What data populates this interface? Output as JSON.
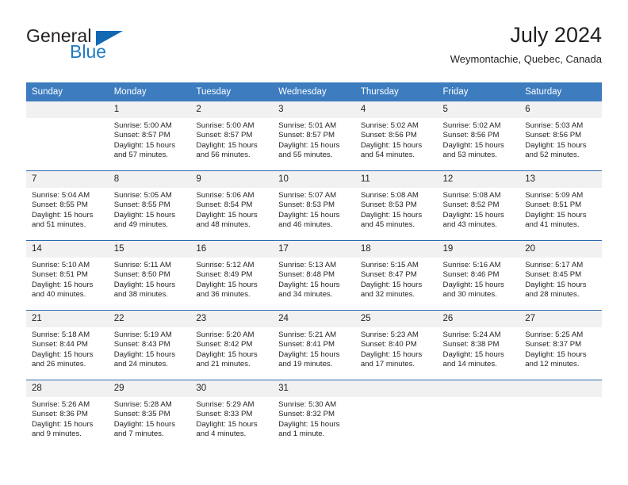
{
  "brand": {
    "name_top": "General",
    "name_bottom": "Blue",
    "accent_color": "#1268b3",
    "text_color": "#231f20"
  },
  "header": {
    "title": "July 2024",
    "location": "Weymontachie, Quebec, Canada"
  },
  "theme": {
    "header_bar_color": "#3c7cbf",
    "row_divider_color": "#2a6cad",
    "daynum_band_color": "#f1f1f1"
  },
  "weekday_headers": [
    "Sunday",
    "Monday",
    "Tuesday",
    "Wednesday",
    "Thursday",
    "Friday",
    "Saturday"
  ],
  "weeks": [
    [
      {
        "day": "",
        "sunrise": "",
        "sunset": "",
        "daylight_line1": "",
        "daylight_line2": ""
      },
      {
        "day": "1",
        "sunrise": "Sunrise: 5:00 AM",
        "sunset": "Sunset: 8:57 PM",
        "daylight_line1": "Daylight: 15 hours",
        "daylight_line2": "and 57 minutes."
      },
      {
        "day": "2",
        "sunrise": "Sunrise: 5:00 AM",
        "sunset": "Sunset: 8:57 PM",
        "daylight_line1": "Daylight: 15 hours",
        "daylight_line2": "and 56 minutes."
      },
      {
        "day": "3",
        "sunrise": "Sunrise: 5:01 AM",
        "sunset": "Sunset: 8:57 PM",
        "daylight_line1": "Daylight: 15 hours",
        "daylight_line2": "and 55 minutes."
      },
      {
        "day": "4",
        "sunrise": "Sunrise: 5:02 AM",
        "sunset": "Sunset: 8:56 PM",
        "daylight_line1": "Daylight: 15 hours",
        "daylight_line2": "and 54 minutes."
      },
      {
        "day": "5",
        "sunrise": "Sunrise: 5:02 AM",
        "sunset": "Sunset: 8:56 PM",
        "daylight_line1": "Daylight: 15 hours",
        "daylight_line2": "and 53 minutes."
      },
      {
        "day": "6",
        "sunrise": "Sunrise: 5:03 AM",
        "sunset": "Sunset: 8:56 PM",
        "daylight_line1": "Daylight: 15 hours",
        "daylight_line2": "and 52 minutes."
      }
    ],
    [
      {
        "day": "7",
        "sunrise": "Sunrise: 5:04 AM",
        "sunset": "Sunset: 8:55 PM",
        "daylight_line1": "Daylight: 15 hours",
        "daylight_line2": "and 51 minutes."
      },
      {
        "day": "8",
        "sunrise": "Sunrise: 5:05 AM",
        "sunset": "Sunset: 8:55 PM",
        "daylight_line1": "Daylight: 15 hours",
        "daylight_line2": "and 49 minutes."
      },
      {
        "day": "9",
        "sunrise": "Sunrise: 5:06 AM",
        "sunset": "Sunset: 8:54 PM",
        "daylight_line1": "Daylight: 15 hours",
        "daylight_line2": "and 48 minutes."
      },
      {
        "day": "10",
        "sunrise": "Sunrise: 5:07 AM",
        "sunset": "Sunset: 8:53 PM",
        "daylight_line1": "Daylight: 15 hours",
        "daylight_line2": "and 46 minutes."
      },
      {
        "day": "11",
        "sunrise": "Sunrise: 5:08 AM",
        "sunset": "Sunset: 8:53 PM",
        "daylight_line1": "Daylight: 15 hours",
        "daylight_line2": "and 45 minutes."
      },
      {
        "day": "12",
        "sunrise": "Sunrise: 5:08 AM",
        "sunset": "Sunset: 8:52 PM",
        "daylight_line1": "Daylight: 15 hours",
        "daylight_line2": "and 43 minutes."
      },
      {
        "day": "13",
        "sunrise": "Sunrise: 5:09 AM",
        "sunset": "Sunset: 8:51 PM",
        "daylight_line1": "Daylight: 15 hours",
        "daylight_line2": "and 41 minutes."
      }
    ],
    [
      {
        "day": "14",
        "sunrise": "Sunrise: 5:10 AM",
        "sunset": "Sunset: 8:51 PM",
        "daylight_line1": "Daylight: 15 hours",
        "daylight_line2": "and 40 minutes."
      },
      {
        "day": "15",
        "sunrise": "Sunrise: 5:11 AM",
        "sunset": "Sunset: 8:50 PM",
        "daylight_line1": "Daylight: 15 hours",
        "daylight_line2": "and 38 minutes."
      },
      {
        "day": "16",
        "sunrise": "Sunrise: 5:12 AM",
        "sunset": "Sunset: 8:49 PM",
        "daylight_line1": "Daylight: 15 hours",
        "daylight_line2": "and 36 minutes."
      },
      {
        "day": "17",
        "sunrise": "Sunrise: 5:13 AM",
        "sunset": "Sunset: 8:48 PM",
        "daylight_line1": "Daylight: 15 hours",
        "daylight_line2": "and 34 minutes."
      },
      {
        "day": "18",
        "sunrise": "Sunrise: 5:15 AM",
        "sunset": "Sunset: 8:47 PM",
        "daylight_line1": "Daylight: 15 hours",
        "daylight_line2": "and 32 minutes."
      },
      {
        "day": "19",
        "sunrise": "Sunrise: 5:16 AM",
        "sunset": "Sunset: 8:46 PM",
        "daylight_line1": "Daylight: 15 hours",
        "daylight_line2": "and 30 minutes."
      },
      {
        "day": "20",
        "sunrise": "Sunrise: 5:17 AM",
        "sunset": "Sunset: 8:45 PM",
        "daylight_line1": "Daylight: 15 hours",
        "daylight_line2": "and 28 minutes."
      }
    ],
    [
      {
        "day": "21",
        "sunrise": "Sunrise: 5:18 AM",
        "sunset": "Sunset: 8:44 PM",
        "daylight_line1": "Daylight: 15 hours",
        "daylight_line2": "and 26 minutes."
      },
      {
        "day": "22",
        "sunrise": "Sunrise: 5:19 AM",
        "sunset": "Sunset: 8:43 PM",
        "daylight_line1": "Daylight: 15 hours",
        "daylight_line2": "and 24 minutes."
      },
      {
        "day": "23",
        "sunrise": "Sunrise: 5:20 AM",
        "sunset": "Sunset: 8:42 PM",
        "daylight_line1": "Daylight: 15 hours",
        "daylight_line2": "and 21 minutes."
      },
      {
        "day": "24",
        "sunrise": "Sunrise: 5:21 AM",
        "sunset": "Sunset: 8:41 PM",
        "daylight_line1": "Daylight: 15 hours",
        "daylight_line2": "and 19 minutes."
      },
      {
        "day": "25",
        "sunrise": "Sunrise: 5:23 AM",
        "sunset": "Sunset: 8:40 PM",
        "daylight_line1": "Daylight: 15 hours",
        "daylight_line2": "and 17 minutes."
      },
      {
        "day": "26",
        "sunrise": "Sunrise: 5:24 AM",
        "sunset": "Sunset: 8:38 PM",
        "daylight_line1": "Daylight: 15 hours",
        "daylight_line2": "and 14 minutes."
      },
      {
        "day": "27",
        "sunrise": "Sunrise: 5:25 AM",
        "sunset": "Sunset: 8:37 PM",
        "daylight_line1": "Daylight: 15 hours",
        "daylight_line2": "and 12 minutes."
      }
    ],
    [
      {
        "day": "28",
        "sunrise": "Sunrise: 5:26 AM",
        "sunset": "Sunset: 8:36 PM",
        "daylight_line1": "Daylight: 15 hours",
        "daylight_line2": "and 9 minutes."
      },
      {
        "day": "29",
        "sunrise": "Sunrise: 5:28 AM",
        "sunset": "Sunset: 8:35 PM",
        "daylight_line1": "Daylight: 15 hours",
        "daylight_line2": "and 7 minutes."
      },
      {
        "day": "30",
        "sunrise": "Sunrise: 5:29 AM",
        "sunset": "Sunset: 8:33 PM",
        "daylight_line1": "Daylight: 15 hours",
        "daylight_line2": "and 4 minutes."
      },
      {
        "day": "31",
        "sunrise": "Sunrise: 5:30 AM",
        "sunset": "Sunset: 8:32 PM",
        "daylight_line1": "Daylight: 15 hours",
        "daylight_line2": "and 1 minute."
      },
      {
        "day": "",
        "sunrise": "",
        "sunset": "",
        "daylight_line1": "",
        "daylight_line2": ""
      },
      {
        "day": "",
        "sunrise": "",
        "sunset": "",
        "daylight_line1": "",
        "daylight_line2": ""
      },
      {
        "day": "",
        "sunrise": "",
        "sunset": "",
        "daylight_line1": "",
        "daylight_line2": ""
      }
    ]
  ]
}
